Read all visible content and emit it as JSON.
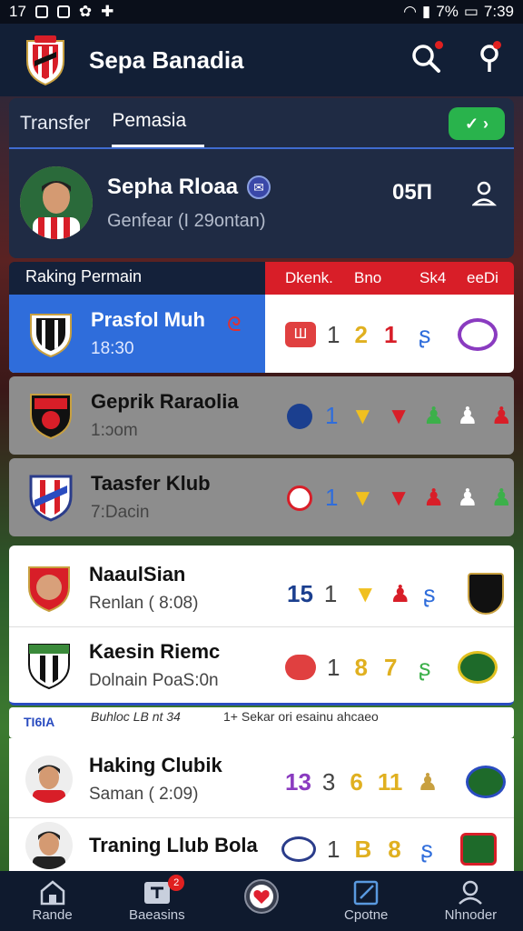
{
  "status_bar": {
    "time_left": "17",
    "battery": "7%",
    "time": "7:39"
  },
  "header": {
    "title": "Sepa Banadia"
  },
  "tabs": [
    {
      "label": "Transfer"
    },
    {
      "label": "Pemasia"
    }
  ],
  "toggle": {
    "label": "✓ ›"
  },
  "profile": {
    "name": "Sepha Rloaa",
    "subtitle": "Genfear (I 29ontan)",
    "score": "05П"
  },
  "ranking": {
    "title": "Raking Permain",
    "columns": [
      "Dkenk.",
      "Bno",
      "Sk4",
      "eeDi"
    ]
  },
  "rows": [
    {
      "title": "Prasfol Muh",
      "subtitle": "18:30",
      "nums": [
        "1",
        "2",
        "1"
      ]
    },
    {
      "title": "Geprik Raraolia",
      "subtitle": "1:ɔom",
      "nums": [
        "1"
      ]
    },
    {
      "title": "Taasfer Klub",
      "subtitle": "7:Dacin",
      "nums": [
        "1"
      ]
    },
    {
      "title": "NaaulSian",
      "subtitle": "Renlan ( 8:08)",
      "nums": [
        "15",
        "1"
      ]
    },
    {
      "title": "Kaesin Riemc",
      "subtitle": "Dolnain PoaS:0n",
      "nums": [
        "1",
        "8",
        "7"
      ]
    },
    {
      "title": "Haking Clubik",
      "subtitle": "Saman ( 2:09)",
      "nums": [
        "13",
        "3",
        "6",
        "11"
      ]
    },
    {
      "title": "Traning Llub Bola",
      "subtitle": "",
      "nums": [
        "1",
        "B",
        "8"
      ]
    }
  ],
  "divider": {
    "left": "TI6IA",
    "mid": "Buhloc LB nt 34",
    "right": "1+ Sekar ori esainu ahcaeo"
  },
  "nav": [
    {
      "label": "Rande"
    },
    {
      "label": "Baeasins",
      "badge": "2"
    },
    {
      "label": ""
    },
    {
      "label": "Cpotne"
    },
    {
      "label": "Nhnoder"
    }
  ],
  "colors": {
    "header": "#121f36",
    "red": "#d81e28",
    "blue": "#2f6ddb",
    "green": "#29b34c"
  }
}
